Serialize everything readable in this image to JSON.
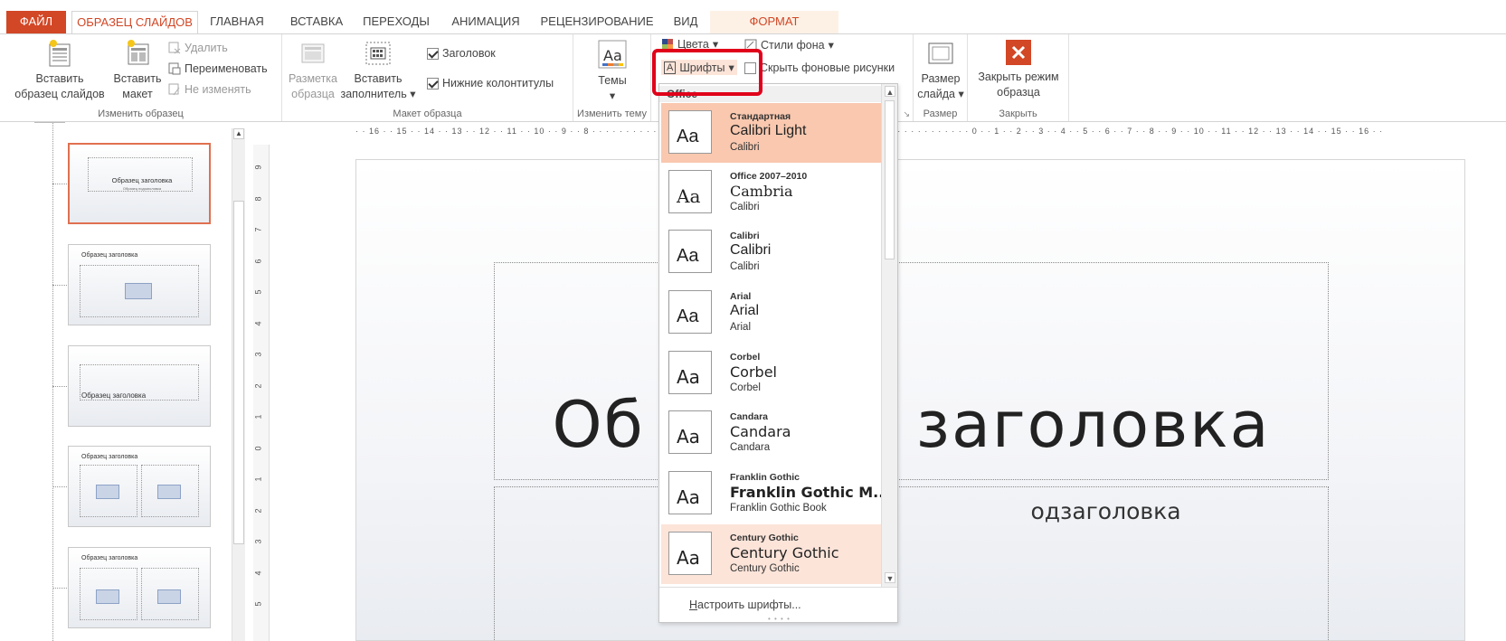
{
  "tabs": {
    "file": "ФАЙЛ",
    "slide_master": "ОБРАЗЕЦ СЛАЙДОВ",
    "home": "ГЛАВНАЯ",
    "insert": "ВСТАВКА",
    "transitions": "ПЕРЕХОДЫ",
    "animations": "АНИМАЦИЯ",
    "review": "РЕЦЕНЗИРОВАНИЕ",
    "view": "ВИД",
    "format": "ФОРМАТ"
  },
  "ribbon": {
    "edit_master": {
      "insert_master_l1": "Вставить",
      "insert_master_l2": "образец слайдов",
      "insert_layout_l1": "Вставить",
      "insert_layout_l2": "макет",
      "delete": "Удалить",
      "rename": "Переименовать",
      "preserve": "Не изменять",
      "label": "Изменить образец"
    },
    "master_layout": {
      "layout_l1": "Разметка",
      "layout_l2": "образца",
      "insert_ph_l1": "Вставить",
      "insert_ph_l2": "заполнитель",
      "title_chk": "Заголовок",
      "footers_chk": "Нижние колонтитулы",
      "label": "Макет образца"
    },
    "edit_theme": {
      "themes": "Темы",
      "label": "Изменить тему"
    },
    "background": {
      "colors": "Цвета",
      "fonts": "Шрифты",
      "bg_styles": "Стили фона",
      "hide_bg": "Скрыть фоновые рисунки"
    },
    "size": {
      "slide_size_l1": "Размер",
      "slide_size_l2": "слайда",
      "label": "Размер"
    },
    "close": {
      "close_l1": "Закрыть режим",
      "close_l2": "образца",
      "label": "Закрыть"
    }
  },
  "thumbnails": [
    {
      "title": "Образец заголовка",
      "sub": "Образец подзаголовка"
    },
    {
      "title": "Образец заголовка"
    },
    {
      "title": "Образец заголовка"
    },
    {
      "title": "Образец заголовка"
    },
    {
      "title": "Образец заголовка"
    }
  ],
  "vruler_labels": [
    "9",
    "8",
    "7",
    "6",
    "5",
    "4",
    "3",
    "2",
    "1",
    "0",
    "1",
    "2",
    "3",
    "4",
    "5"
  ],
  "hruler_text": "· · 16 · · 15 · · 14 · · 13 · · 12 · · 11 · · 10 · · 9 · · 8 · · · · · · · · · · · · · · · · · · · · · · · · · · · · · · · · · · · · · · · · · · · · · · · · · · · · · · · · 0 · · 1 · · 2 · · 3 · · 4 · · 5 · · 6 · · 7 · · 8 · · 9 · · 10 · · 11 · · 12 · · 13 · · 14 · · 15 · · 16 · ·",
  "slide": {
    "title_left": "Об",
    "title_right": "заголовка",
    "subtitle_right": "одзаголовка"
  },
  "fonts_dropdown": {
    "header": "Office",
    "items": [
      {
        "name": "Стандартная",
        "heading": "Calibri Light",
        "body": "Calibri"
      },
      {
        "name": "Office 2007–2010",
        "heading": "Cambria",
        "body": "Calibri"
      },
      {
        "name": "Calibri",
        "heading": "Calibri",
        "body": "Calibri"
      },
      {
        "name": "Arial",
        "heading": "Arial",
        "body": "Arial"
      },
      {
        "name": "Corbel",
        "heading": "Corbel",
        "body": "Corbel"
      },
      {
        "name": "Candara",
        "heading": "Candara",
        "body": "Candara"
      },
      {
        "name": "Franklin Gothic",
        "heading": "Franklin Gothic M...",
        "body": "Franklin Gothic Book"
      },
      {
        "name": "Century Gothic",
        "heading": "Century Gothic",
        "body": "Century Gothic"
      }
    ],
    "aa": "Aa",
    "customize_u": "Н",
    "customize_rest": "астроить шрифты..."
  },
  "colors": {
    "accent": "#d24726",
    "highlight": "#e0001a"
  }
}
